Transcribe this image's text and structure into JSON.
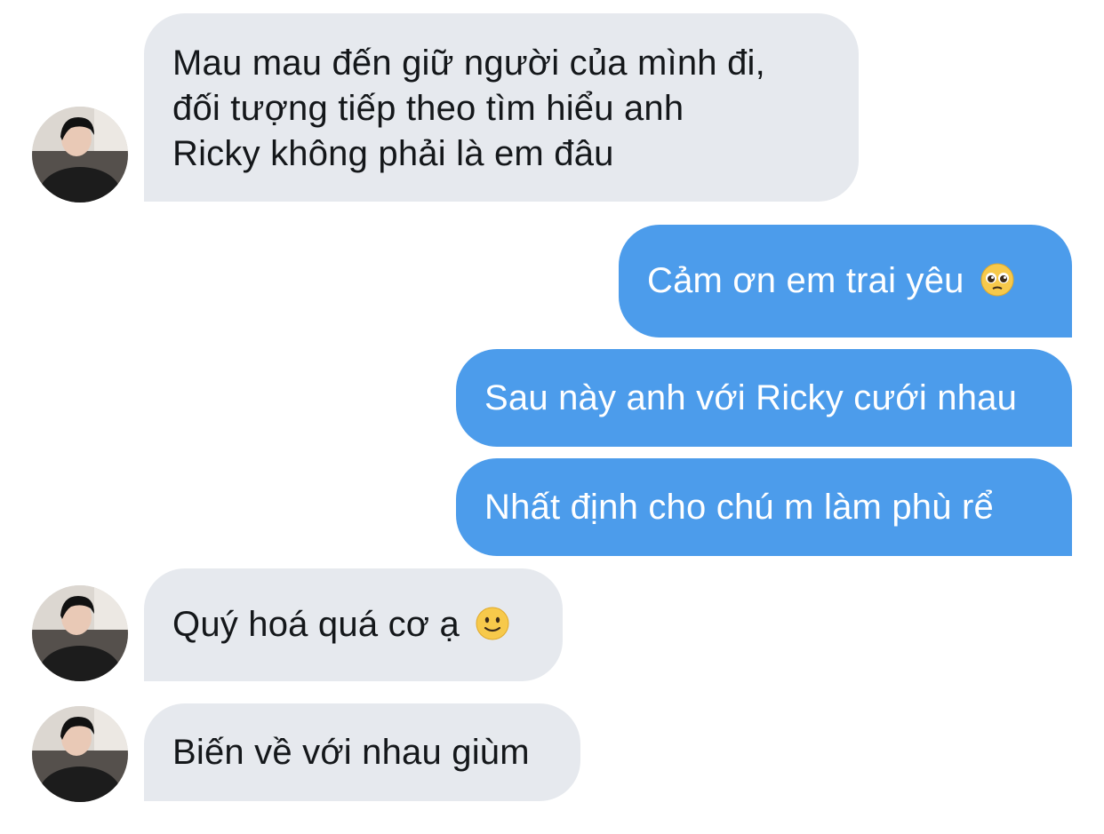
{
  "conversation": {
    "messages": [
      {
        "direction": "incoming",
        "lines": [
          "Mau mau đến giữ người của mình đi,",
          "đối tượng tiếp theo tìm hiểu anh",
          "Ricky không phải là em đâu"
        ]
      },
      {
        "direction": "outgoing",
        "text": "Cảm ơn em trai yêu",
        "emoji": "pleading-face-icon"
      },
      {
        "direction": "outgoing",
        "text": "Sau này anh với Ricky cưới nhau"
      },
      {
        "direction": "outgoing",
        "text": "Nhất định cho chú m làm phù rể"
      },
      {
        "direction": "incoming",
        "text": "Quý hoá quá cơ ạ",
        "emoji": "slightly-smiling-face-icon"
      },
      {
        "direction": "incoming",
        "text": "Biến về với nhau giùm"
      }
    ]
  },
  "colors": {
    "incoming_bubble": "#e6e9ee",
    "outgoing_bubble": "#4c9ceb",
    "incoming_text": "#14171a",
    "outgoing_text": "#ffffff"
  }
}
